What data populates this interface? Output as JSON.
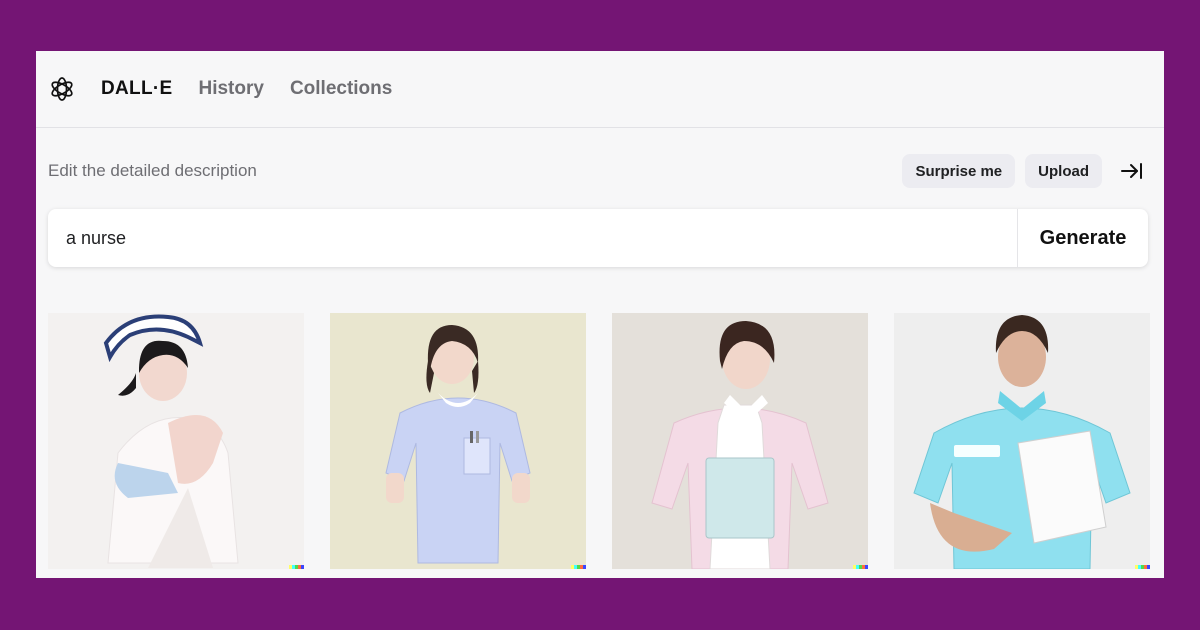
{
  "nav": {
    "logo_icon": "openai-logo-icon",
    "brand": "DALL·E",
    "history": "History",
    "collections": "Collections"
  },
  "editor": {
    "label": "Edit the detailed description",
    "surprise_label": "Surprise me",
    "upload_label": "Upload",
    "collapse_icon": "arrow-right-to-bar-icon",
    "prompt_value": "a nurse",
    "generate_label": "Generate"
  },
  "results": [
    {
      "subject": "nurse-cap-white-uniform",
      "bg": "#f3f1f0",
      "uniform": "#fbf8f8"
    },
    {
      "subject": "nurse-lavender-tunic",
      "bg": "#e9e6cf",
      "uniform": "#c9d3f4"
    },
    {
      "subject": "nurse-pink-apron",
      "bg": "#e4e0da",
      "uniform": "#f4dbe6"
    },
    {
      "subject": "nurse-cyan-clipboard",
      "bg": "#eeeeee",
      "uniform": "#8fe0ef"
    }
  ],
  "watermark_colors": [
    "#ffff66",
    "#42ffff",
    "#51da4c",
    "#ff6e3c",
    "#3c46ff"
  ],
  "theme": {
    "page_background": "#741574",
    "window_background": "#f7f7f8"
  }
}
